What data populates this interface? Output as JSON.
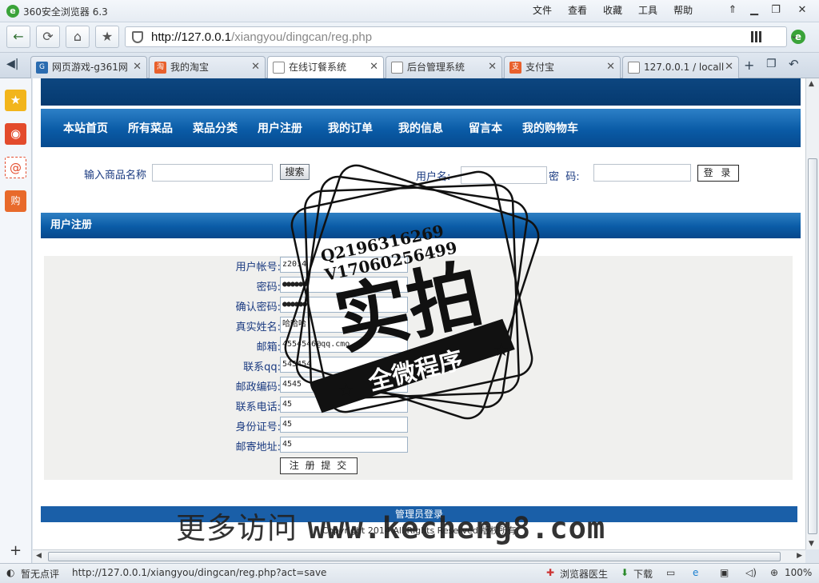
{
  "browser": {
    "title": "360安全浏览器 6.3",
    "menus": [
      "文件",
      "查看",
      "收藏",
      "工具",
      "帮助"
    ],
    "url_host": "http://127.0.0.1",
    "url_path": "/xiangyou/dingcan/reg.php",
    "tabs": [
      {
        "label": "网页游戏-g361网",
        "icon": "game-icon",
        "color": "#2b6cb0"
      },
      {
        "label": "我的淘宝",
        "icon": "taobao-icon",
        "color": "#e8602c"
      },
      {
        "label": "在线订餐系统",
        "icon": "page-icon",
        "color": "#ffffff"
      },
      {
        "label": "后台管理系统",
        "icon": "page-icon",
        "color": "#ffffff"
      },
      {
        "label": "支付宝",
        "icon": "alipay-icon",
        "color": "#e8602c"
      },
      {
        "label": "127.0.0.1 / locall",
        "icon": "page-icon",
        "color": "#ffffff"
      }
    ]
  },
  "site": {
    "nav": [
      "本站首页",
      "所有菜品",
      "菜品分类",
      "用户注册",
      "我的订单",
      "我的信息",
      "留言本",
      "我的购物车"
    ],
    "search": {
      "label": "输入商品名称",
      "button": "搜索"
    },
    "login": {
      "username_label": "用户名:",
      "password_label": "密  码:",
      "button": "登 录"
    },
    "section_title": "用户注册",
    "form": [
      {
        "label": "用户帐号:",
        "value": "z2014",
        "masked": false
      },
      {
        "label": "密码:",
        "value": "●●●●●●",
        "masked": true
      },
      {
        "label": "确认密码:",
        "value": "●●●●●●",
        "masked": true
      },
      {
        "label": "真实姓名:",
        "value": "哈哈哈",
        "masked": false
      },
      {
        "label": "邮箱:",
        "value": "4554546@qq.cmo",
        "masked": false
      },
      {
        "label": "联系qq:",
        "value": "545454",
        "masked": false
      },
      {
        "label": "邮政编码:",
        "value": "4545",
        "masked": false
      },
      {
        "label": "联系电话:",
        "value": "45",
        "masked": false
      },
      {
        "label": "身份证号:",
        "value": "45",
        "masked": false
      },
      {
        "label": "邮寄地址:",
        "value": "45",
        "masked": false
      }
    ],
    "submit": "注 册 提 交",
    "footer_link": "管理员登录",
    "copyright": "Copyright 2014 All Rights Reserved 版权所有"
  },
  "watermark": {
    "q": "Q2196316269",
    "v": "V17060256499",
    "big": "实拍",
    "banner": "全微程序",
    "bottom_cn": "更多访问",
    "bottom_url": "www.kecheng8.com"
  },
  "status": {
    "rating": "暂无点评",
    "url": "http://127.0.0.1/xiangyou/dingcan/reg.php?act=save",
    "doctor": "浏览器医生",
    "download": "下载",
    "zoom": "100%"
  }
}
